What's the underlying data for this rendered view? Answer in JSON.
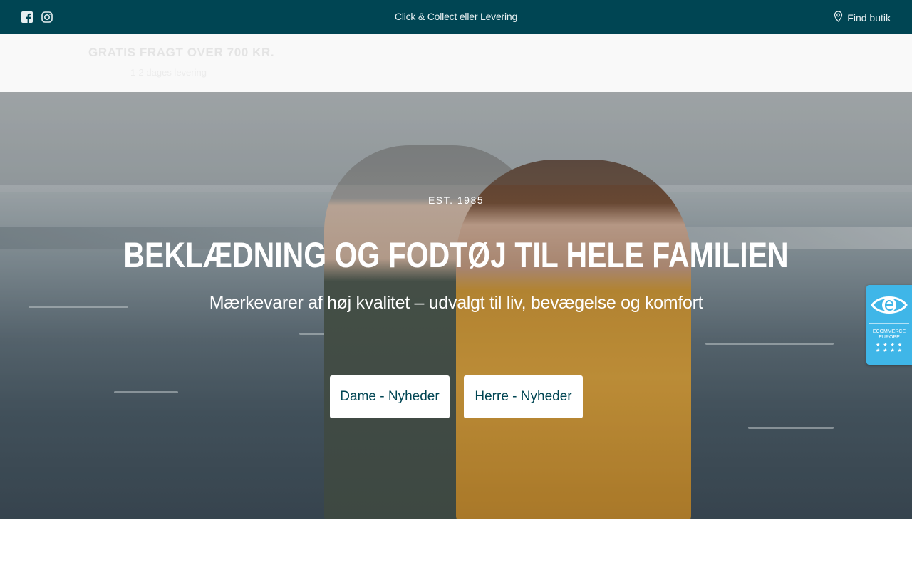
{
  "topbar": {
    "social_icons": [
      "facebook-icon",
      "instagram-icon"
    ],
    "center_text": "Click & Collect eller Levering",
    "find_shop_label": "Find butik",
    "background": "#004553"
  },
  "subbar": {
    "promo_title": "GRATIS FRAGT OVER 700 KR.",
    "promo_sub": "1-2 dages levering"
  },
  "hero": {
    "est": "EST. 1985",
    "headline": "BEKLÆDNING OG FODTØJ TIL HELE FAMILIEN",
    "subheadline": "Mærkevarer af høj kvalitet – udvalgt til liv, bevægelse og komfort",
    "buttons": [
      {
        "label": "Dame - Nyheder"
      },
      {
        "label": "Herre - Nyheder"
      }
    ]
  },
  "badge": {
    "label": "ECOMMERCE EUROPE",
    "color": "#3fb6e8"
  }
}
